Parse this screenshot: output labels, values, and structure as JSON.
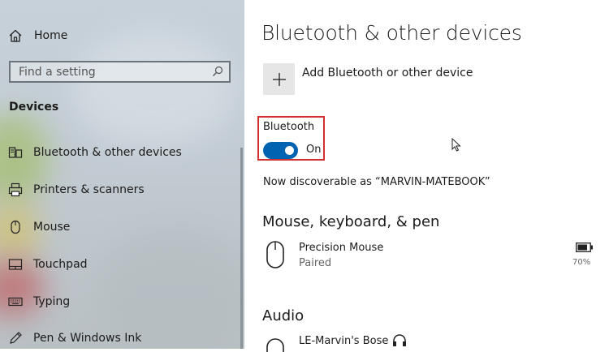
{
  "sidebar": {
    "home_label": "Home",
    "search_placeholder": "Find a setting",
    "section_title": "Devices",
    "items": [
      {
        "label": "Bluetooth & other devices",
        "icon": "bluetooth-devices-icon"
      },
      {
        "label": "Printers & scanners",
        "icon": "printer-icon"
      },
      {
        "label": "Mouse",
        "icon": "mouse-icon"
      },
      {
        "label": "Touchpad",
        "icon": "touchpad-icon"
      },
      {
        "label": "Typing",
        "icon": "keyboard-icon"
      },
      {
        "label": "Pen & Windows Ink",
        "icon": "pen-icon"
      }
    ]
  },
  "main": {
    "title": "Bluetooth & other devices",
    "add_device_label": "Add Bluetooth or other device",
    "bluetooth": {
      "label": "Bluetooth",
      "state": "On",
      "enabled": true
    },
    "discoverable_text": "Now discoverable as “MARVIN-MATEBOOK”",
    "sections": {
      "mouse_keyboard_pen": "Mouse, keyboard, & pen",
      "audio": "Audio"
    },
    "devices": {
      "mouse": {
        "name": "Precision Mouse",
        "status": "Paired",
        "battery": "70%"
      },
      "audio": {
        "name": "LE-Marvin's Bose"
      }
    }
  },
  "colors": {
    "accent": "#0063b1",
    "highlight_border": "#d32f2f"
  }
}
